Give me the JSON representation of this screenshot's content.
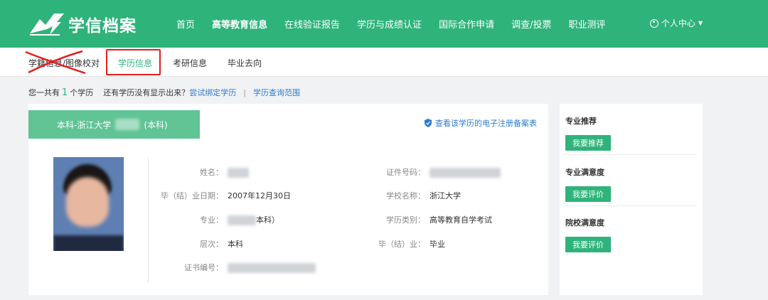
{
  "header": {
    "logo_text": "学信档案",
    "nav": [
      "首页",
      "高等教育信息",
      "在线验证报告",
      "学历与成绩认证",
      "国际合作申请",
      "调查/投票",
      "职业测评"
    ],
    "user_menu": "个人中心",
    "colors": {
      "brand": "#2eb37b"
    }
  },
  "subnav": {
    "items": [
      "学籍信息/图像校对",
      "学历信息",
      "考研信息",
      "毕业去向"
    ],
    "active": "学历信息"
  },
  "summary": {
    "prefix": "您一共有",
    "count": "1",
    "suffix": "个学历",
    "hint": "还有学历没有显示出来？",
    "bind_link": "尝试绑定学历",
    "sep": "|",
    "scope_link": "学历查询范围"
  },
  "record": {
    "tab_prefix": "本科-浙江大学",
    "tab_suffix": "(本科)",
    "register_link": "查看该学历的电子注册备案表",
    "fields": {
      "name_label": "姓名：",
      "grad_date_label": "毕（结）业日期：",
      "grad_date_value": "2007年12月30日",
      "major_label": "专业：",
      "major_value": "本科）",
      "level_label": "层次：",
      "level_value": "本科",
      "cert_no_label": "证书编号：",
      "id_label": "证件号码：",
      "school_label": "学校名称：",
      "school_value": "浙江大学",
      "type_label": "学历类别：",
      "type_value": "高等教育自学考试",
      "status_label": "毕（结）业：",
      "status_value": "毕业"
    }
  },
  "side": {
    "sections": [
      {
        "title": "专业推荐",
        "button": "我要推荐"
      },
      {
        "title": "专业满意度",
        "button": "我要评价"
      },
      {
        "title": "院校满意度",
        "button": "我要评价"
      }
    ]
  }
}
